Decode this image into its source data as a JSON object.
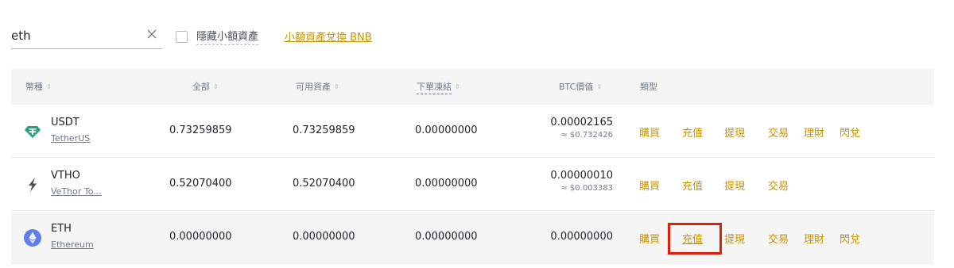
{
  "search": {
    "value": "eth",
    "clear_icon": "close-icon"
  },
  "filters": {
    "hide_small_label": "隱藏小額資產",
    "convert_link": "小額資產兌換 BNB"
  },
  "colors": {
    "accent": "#f0b90b",
    "action": "#c99400",
    "highlight": "#e11d0b"
  },
  "table": {
    "headers": {
      "coin": "幣種",
      "total": "全部",
      "available": "可用資產",
      "in_order": "下單凍結",
      "btc_value": "BTC價值",
      "type": "類型"
    },
    "sort_icon": "sort-icon",
    "rows": [
      {
        "icon": "tether-icon",
        "symbol": "USDT",
        "name": "TetherUS",
        "total": "0.73259859",
        "available": "0.73259859",
        "in_order": "0.00000000",
        "btc": "0.00002165",
        "usd": "≈ $0.732426",
        "actions": {
          "buy": "購買",
          "deposit": "充值",
          "withdraw": "提現",
          "trade": "交易",
          "earn": "理財",
          "convert": "閃兌"
        }
      },
      {
        "icon": "lightning-icon",
        "symbol": "VTHO",
        "name": "VeThor To...",
        "total": "0.52070400",
        "available": "0.52070400",
        "in_order": "0.00000000",
        "btc": "0.00000010",
        "usd": "≈ $0.003383",
        "actions": {
          "buy": "購買",
          "deposit": "充值",
          "withdraw": "提現",
          "trade": "交易"
        }
      },
      {
        "icon": "ethereum-icon",
        "symbol": "ETH",
        "name": "Ethereum",
        "total": "0.00000000",
        "available": "0.00000000",
        "in_order": "0.00000000",
        "btc": "0.00000000",
        "actions": {
          "buy": "購買",
          "deposit": "充值",
          "withdraw": "提現",
          "trade": "交易",
          "earn": "理財",
          "convert": "閃兌"
        }
      }
    ]
  }
}
